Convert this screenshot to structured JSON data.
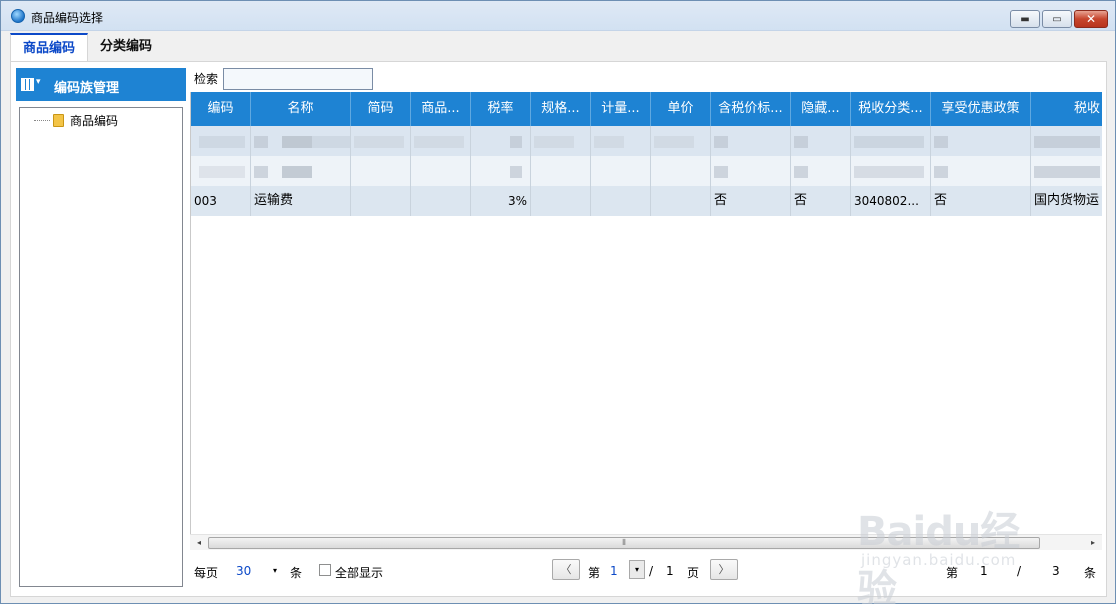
{
  "window": {
    "title": "商品编码选择",
    "minimize_glyph": "▬",
    "maximize_glyph": "▭",
    "close_glyph": "✕"
  },
  "tabs": [
    {
      "label": "商品编码",
      "active": true
    },
    {
      "label": "分类编码",
      "active": false
    }
  ],
  "sidebar": {
    "header": "编码族管理",
    "header_caret": "▾",
    "tree_items": [
      {
        "label": "商品编码"
      }
    ]
  },
  "search": {
    "label": "检索",
    "value": ""
  },
  "grid": {
    "columns": [
      "编码",
      "名称",
      "简码",
      "商品...",
      "税率",
      "规格...",
      "计量...",
      "单价",
      "含税价标...",
      "隐藏...",
      "税收分类...",
      "享受优惠政策",
      "税收"
    ],
    "rows": [
      {
        "code": "003",
        "name": "运输费",
        "short_code": "",
        "product": "",
        "tax_rate": "3%",
        "spec": "",
        "unit": "",
        "price": "",
        "tax_included": "否",
        "hidden": "否",
        "tax_category": "3040802...",
        "preferential": "否",
        "tax_desc": "国内货物运"
      }
    ]
  },
  "scrollbar": {
    "left": "◂",
    "right": "▸",
    "grip": "⦀"
  },
  "footer": {
    "per_page_label": "每页",
    "per_page_value": "30",
    "per_page_unit": "条",
    "show_all_label": "全部显示",
    "prev": "〈",
    "next": "〉",
    "page_label": "第",
    "current_page": "1",
    "separator": "/",
    "total_pages": "1",
    "page_unit": "页",
    "record_label": "第",
    "record_from": "1",
    "record_sep": "/",
    "record_total": "3",
    "record_unit": "条",
    "combo_arrow": "▾"
  },
  "watermark": {
    "logo": "Baidu经验",
    "url": "jingyan.baidu.com"
  }
}
